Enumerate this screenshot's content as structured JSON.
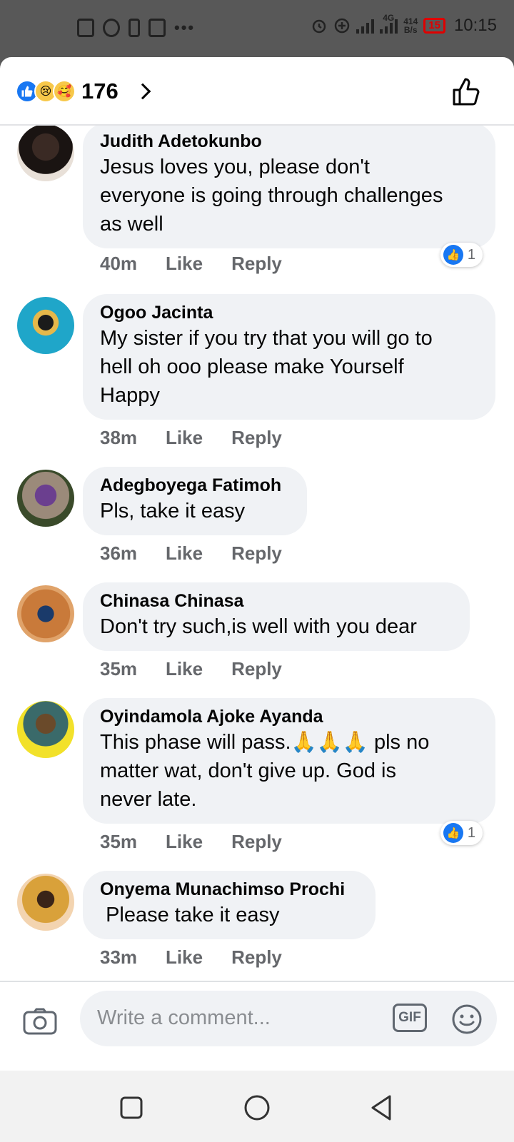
{
  "status_bar": {
    "network": "4G",
    "speed_value": "414",
    "speed_unit": "B/s",
    "battery": "15",
    "time": "10:15",
    "left_icons": [
      "notes-icon",
      "messenger-icon",
      "sim-icon",
      "save-icon",
      "more-dots-icon"
    ],
    "right_icons": [
      "alarm-icon",
      "add-circle-icon",
      "signal-icon",
      "signal-4g-icon"
    ]
  },
  "header": {
    "reactions": [
      "like-reaction-icon",
      "sad-reaction-icon",
      "care-reaction-icon"
    ],
    "reaction_count": "176",
    "like_button_icon": "thumbs-up-outline-icon"
  },
  "comments": [
    {
      "author": "Judith Adetokunbo",
      "text": "Jesus loves you, please don't\neveryone is going through challenges\nas well",
      "time": "40m",
      "like_label": "Like",
      "reply_label": "Reply",
      "reaction_count": "1"
    },
    {
      "author": "Ogoo Jacinta",
      "text": "My sister if you try that you will go to\nhell oh ooo please make Yourself\nHappy",
      "time": "38m",
      "like_label": "Like",
      "reply_label": "Reply"
    },
    {
      "author": "Adegboyega Fatimoh",
      "text": "Pls, take it easy",
      "time": "36m",
      "like_label": "Like",
      "reply_label": "Reply"
    },
    {
      "author": "Chinasa Chinasa",
      "text": "Don't try such,is well with you dear",
      "time": "35m",
      "like_label": "Like",
      "reply_label": "Reply"
    },
    {
      "author": "Oyindamola Ajoke Ayanda",
      "text": "This phase will pass.🙏🙏🙏 pls no\nmatter wat, don't give up. God is\nnever late.",
      "time": "35m",
      "like_label": "Like",
      "reply_label": "Reply",
      "reaction_count": "1"
    },
    {
      "author": "Onyema Munachimso Prochi",
      "text": " Please take it easy",
      "time": "33m",
      "like_label": "Like",
      "reply_label": "Reply"
    }
  ],
  "composer": {
    "placeholder": "Write a comment...",
    "gif_label": "GIF",
    "camera_icon": "camera-icon",
    "emoji_icon": "emoji-icon"
  },
  "nav": [
    "recents-icon",
    "home-icon",
    "back-icon"
  ],
  "colors": {
    "facebook_blue": "#1877f2",
    "bubble_bg": "#f0f2f5",
    "meta_text": "#65676b",
    "status_bar_bg": "#585858",
    "battery_low": "#e00000"
  }
}
